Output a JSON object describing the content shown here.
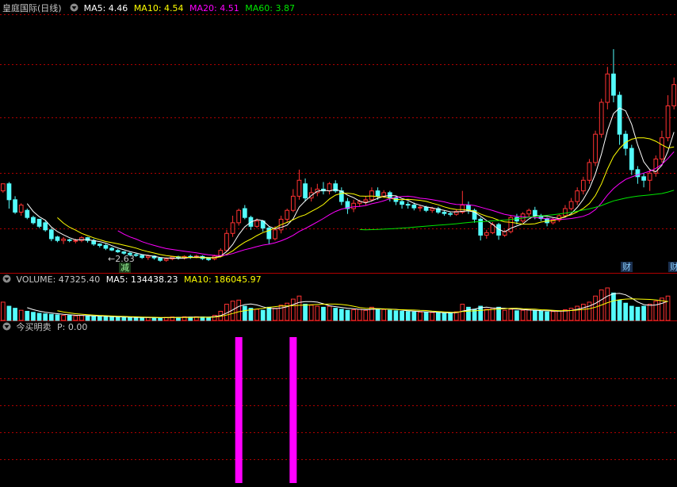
{
  "price_header": {
    "stock_name": "皇庭国际(日线)",
    "ma5": "MA5: 4.46",
    "ma10": "MA10: 4.54",
    "ma20": "MA20: 4.51",
    "ma60": "MA60: 3.87"
  },
  "price_annotations": {
    "low_marker": "←2.63",
    "reduce_tag": "减",
    "finance_tag_1": "财",
    "finance_tag_2": "财"
  },
  "volume_header": {
    "title": "VOLUME: 47325.40",
    "ma5": "MA5: 134438.23",
    "ma10": "MA10: 186045.97"
  },
  "indicator_header": {
    "title": "今买明卖",
    "p_value": "P: 0.00"
  },
  "colors": {
    "up": "#ff3232",
    "down": "#54fcfc",
    "ma5": "#ffffff",
    "ma10": "#ffff00",
    "ma20": "#ff00ff",
    "ma60": "#00e600",
    "signal": "#ff00ff",
    "grid": "#b00000"
  },
  "chart_data": {
    "type": "candlestick",
    "price_low_marker": 2.63,
    "candles": [
      [
        3.6,
        3.8,
        3.55,
        3.6
      ],
      [
        3.8,
        3.35,
        3.1,
        3.85
      ],
      [
        3.35,
        3.0,
        2.95,
        3.45
      ],
      [
        3.0,
        3.2,
        2.9,
        3.25
      ],
      [
        3.05,
        2.85,
        2.8,
        3.1
      ],
      [
        2.85,
        2.7,
        2.65,
        2.9
      ],
      [
        2.8,
        2.6,
        2.55,
        2.8
      ],
      [
        2.7,
        2.5,
        2.45,
        2.75
      ],
      [
        2.5,
        2.25,
        2.18,
        2.55
      ],
      [
        2.3,
        2.2,
        2.15,
        2.33
      ],
      [
        2.2,
        2.24,
        2.1,
        2.3
      ],
      [
        2.22,
        2.2,
        2.15,
        2.25
      ],
      [
        2.2,
        2.2,
        2.12,
        2.25
      ],
      [
        2.2,
        2.28,
        2.15,
        2.32
      ],
      [
        2.28,
        2.2,
        2.14,
        2.3
      ],
      [
        2.2,
        2.1,
        2.05,
        2.25
      ],
      [
        2.1,
        2.06,
        2.0,
        2.12
      ],
      [
        2.06,
        1.98,
        1.93,
        2.1
      ],
      [
        1.98,
        1.93,
        1.9,
        2.02
      ],
      [
        1.92,
        1.88,
        1.85,
        1.96
      ],
      [
        1.88,
        1.84,
        1.8,
        1.9
      ],
      [
        1.84,
        1.8,
        1.76,
        1.88
      ],
      [
        1.8,
        1.78,
        1.74,
        1.84
      ],
      [
        1.78,
        1.72,
        1.68,
        1.8
      ],
      [
        1.72,
        1.76,
        1.65,
        1.8
      ],
      [
        1.76,
        1.71,
        1.66,
        1.78
      ],
      [
        1.7,
        1.64,
        1.6,
        1.72
      ],
      [
        1.64,
        1.68,
        1.6,
        1.72
      ],
      [
        1.68,
        1.74,
        1.64,
        1.76
      ],
      [
        1.74,
        1.7,
        1.66,
        1.77
      ],
      [
        1.7,
        1.75,
        1.66,
        1.78
      ],
      [
        1.75,
        1.73,
        1.68,
        1.8
      ],
      [
        1.73,
        1.76,
        1.7,
        1.8
      ],
      [
        1.75,
        1.69,
        1.65,
        1.78
      ],
      [
        1.69,
        1.66,
        1.62,
        1.72
      ],
      [
        1.68,
        1.76,
        1.64,
        1.8
      ],
      [
        1.76,
        1.92,
        1.72,
        1.98
      ],
      [
        1.92,
        2.4,
        1.9,
        2.5
      ],
      [
        2.4,
        2.7,
        2.3,
        2.9
      ],
      [
        2.7,
        3.05,
        2.62,
        3.1
      ],
      [
        3.1,
        2.85,
        2.8,
        3.2
      ],
      [
        2.85,
        2.6,
        2.5,
        2.9
      ],
      [
        2.6,
        2.75,
        2.55,
        2.82
      ],
      [
        2.75,
        2.55,
        2.45,
        2.78
      ],
      [
        2.55,
        2.25,
        2.1,
        2.6
      ],
      [
        2.25,
        2.5,
        2.2,
        2.6
      ],
      [
        2.5,
        2.8,
        2.4,
        2.9
      ],
      [
        2.8,
        3.05,
        2.7,
        3.1
      ],
      [
        3.05,
        3.45,
        3.0,
        3.65
      ],
      [
        3.45,
        3.9,
        3.35,
        4.2
      ],
      [
        3.8,
        3.4,
        3.3,
        3.95
      ],
      [
        3.4,
        3.55,
        3.3,
        3.7
      ],
      [
        3.55,
        3.65,
        3.45,
        3.8
      ],
      [
        3.65,
        3.6,
        3.5,
        3.85
      ],
      [
        3.6,
        3.8,
        3.5,
        3.85
      ],
      [
        3.8,
        3.6,
        3.55,
        3.9
      ],
      [
        3.6,
        3.3,
        3.2,
        3.7
      ],
      [
        3.3,
        3.1,
        2.95,
        3.4
      ],
      [
        3.1,
        3.25,
        3.0,
        3.35
      ],
      [
        3.25,
        3.3,
        3.15,
        3.35
      ],
      [
        3.3,
        3.35,
        3.2,
        3.45
      ],
      [
        3.35,
        3.6,
        3.3,
        3.7
      ],
      [
        3.6,
        3.45,
        3.35,
        3.7
      ],
      [
        3.45,
        3.55,
        3.4,
        3.62
      ],
      [
        3.55,
        3.4,
        3.3,
        3.6
      ],
      [
        3.4,
        3.3,
        3.2,
        3.45
      ],
      [
        3.3,
        3.22,
        3.1,
        3.35
      ],
      [
        3.22,
        3.2,
        3.1,
        3.3
      ],
      [
        3.2,
        3.12,
        3.05,
        3.27
      ],
      [
        3.12,
        3.14,
        3.02,
        3.2
      ],
      [
        3.14,
        3.05,
        3.0,
        3.18
      ],
      [
        3.05,
        3.1,
        2.98,
        3.15
      ],
      [
        3.1,
        3.0,
        2.95,
        3.15
      ],
      [
        3.0,
        2.96,
        2.9,
        3.05
      ],
      [
        2.96,
        2.94,
        2.88,
        3.0
      ],
      [
        2.94,
        3.02,
        2.9,
        3.08
      ],
      [
        3.0,
        3.2,
        2.95,
        3.6
      ],
      [
        3.2,
        3.05,
        2.95,
        3.3
      ],
      [
        3.05,
        2.8,
        2.7,
        3.1
      ],
      [
        2.8,
        2.35,
        2.2,
        2.85
      ],
      [
        2.35,
        2.42,
        2.25,
        2.5
      ],
      [
        2.42,
        2.65,
        2.38,
        2.72
      ],
      [
        2.65,
        2.35,
        2.22,
        2.7
      ],
      [
        2.35,
        2.45,
        2.3,
        2.5
      ],
      [
        2.45,
        2.85,
        2.4,
        2.9
      ],
      [
        2.85,
        2.75,
        2.65,
        2.95
      ],
      [
        2.75,
        2.95,
        2.7,
        3.0
      ],
      [
        2.95,
        3.05,
        2.85,
        3.1
      ],
      [
        3.05,
        2.9,
        2.8,
        3.15
      ],
      [
        2.9,
        2.82,
        2.75,
        2.95
      ],
      [
        2.82,
        2.7,
        2.6,
        2.85
      ],
      [
        2.7,
        2.78,
        2.65,
        2.85
      ],
      [
        2.78,
        2.9,
        2.72,
        2.95
      ],
      [
        2.9,
        3.1,
        2.85,
        3.2
      ],
      [
        3.1,
        3.3,
        3.05,
        3.4
      ],
      [
        3.3,
        3.6,
        3.2,
        3.7
      ],
      [
        3.6,
        3.9,
        3.5,
        4.0
      ],
      [
        3.9,
        4.4,
        3.8,
        4.5
      ],
      [
        4.4,
        5.2,
        4.3,
        5.3
      ],
      [
        5.2,
        6.1,
        5.1,
        6.2
      ],
      [
        6.1,
        6.9,
        5.9,
        7.1
      ],
      [
        6.9,
        6.3,
        6.1,
        7.6
      ],
      [
        6.3,
        5.2,
        4.9,
        6.4
      ],
      [
        5.2,
        4.8,
        4.6,
        5.3
      ],
      [
        4.8,
        4.2,
        4.05,
        4.9
      ],
      [
        4.2,
        4.0,
        3.8,
        4.3
      ],
      [
        4.0,
        3.9,
        3.7,
        4.1
      ],
      [
        3.9,
        4.1,
        3.6,
        4.2
      ],
      [
        4.1,
        4.5,
        4.0,
        4.6
      ],
      [
        4.5,
        5.1,
        4.4,
        5.3
      ],
      [
        5.1,
        6.0,
        5.0,
        6.3
      ],
      [
        6.0,
        6.6,
        5.9,
        6.8
      ]
    ],
    "volumes": [
      180,
      140,
      120,
      100,
      90,
      80,
      70,
      65,
      60,
      55,
      50,
      48,
      45,
      50,
      44,
      40,
      38,
      36,
      34,
      32,
      30,
      28,
      28,
      26,
      30,
      27,
      25,
      30,
      34,
      30,
      36,
      32,
      36,
      34,
      30,
      50,
      90,
      160,
      190,
      200,
      140,
      120,
      110,
      100,
      130,
      120,
      150,
      170,
      210,
      240,
      160,
      150,
      140,
      130,
      140,
      120,
      110,
      100,
      105,
      110,
      100,
      130,
      115,
      108,
      100,
      95,
      90,
      88,
      84,
      82,
      80,
      78,
      74,
      70,
      72,
      85,
      160,
      130,
      110,
      140,
      110,
      120,
      130,
      100,
      110,
      95,
      100,
      105,
      95,
      90,
      85,
      88,
      95,
      105,
      120,
      140,
      160,
      180,
      240,
      300,
      320,
      270,
      200,
      170,
      140,
      130,
      140,
      160,
      190,
      220,
      240
    ],
    "signal_bars": [
      {
        "index": 39,
        "value": 1
      },
      {
        "index": 48,
        "value": 1
      }
    ]
  }
}
